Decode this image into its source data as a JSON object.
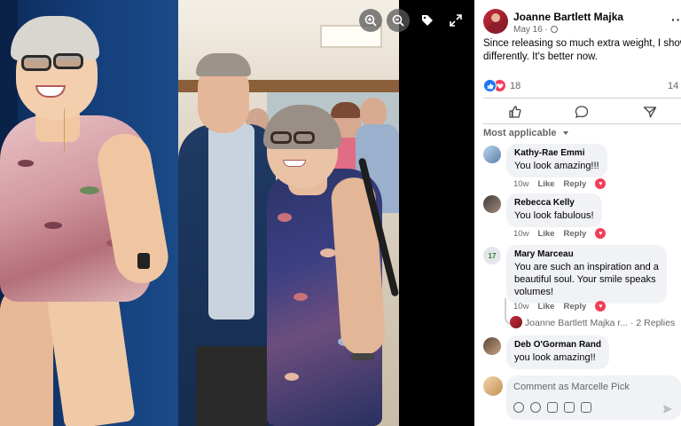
{
  "viewer": {
    "icons": [
      "zoom-in-icon",
      "zoom-out-icon",
      "tag-icon",
      "fullscreen-icon"
    ]
  },
  "post": {
    "author": "Joanne Bartlett Majka",
    "date": "May 16 · ",
    "privacy_icon": "globe-icon",
    "more": "···",
    "text_line1": "Since releasing so much extra weight, I show up",
    "text_line2": "differently. It's better now.",
    "reaction_count": "18",
    "comment_count": "14",
    "reactions": [
      "like",
      "love"
    ],
    "actions": [
      "like-icon",
      "comment-icon",
      "share-icon"
    ]
  },
  "sort_label": "Most applicable",
  "comments": [
    {
      "name": "Kathy-Rae Emmi",
      "text": "You look amazing!!!",
      "time": "10w",
      "like": "Like",
      "reply": "Reply"
    },
    {
      "name": "Rebecca Kelly",
      "text": "You look fabulous!",
      "time": "10w",
      "like": "Like",
      "reply": "Reply"
    },
    {
      "name": "Mary Marceau",
      "text_lines": [
        "You are such an inspiration and a",
        "beautiful soul. Your smile speaks",
        "volumes!"
      ],
      "time": "10w",
      "like": "Like",
      "reply": "Reply"
    },
    {
      "name": "Deb O'Gorman Rand",
      "text": "you look amazing!!"
    }
  ],
  "replies": {
    "author_preview": "Joanne Bartlett Majka r...",
    "count_label": "· 2 Replies"
  },
  "composer": {
    "placeholder": "Comment as Marcelle Pick",
    "tools": [
      "avatar-sticker-icon",
      "emoji-icon",
      "camera-icon",
      "gif-icon",
      "sticker-icon"
    ]
  },
  "colors": {
    "like_blue": "#1877f2",
    "love_red": "#f33e58",
    "bubble_gray": "#f0f2f5",
    "meta_gray": "#65676b"
  }
}
